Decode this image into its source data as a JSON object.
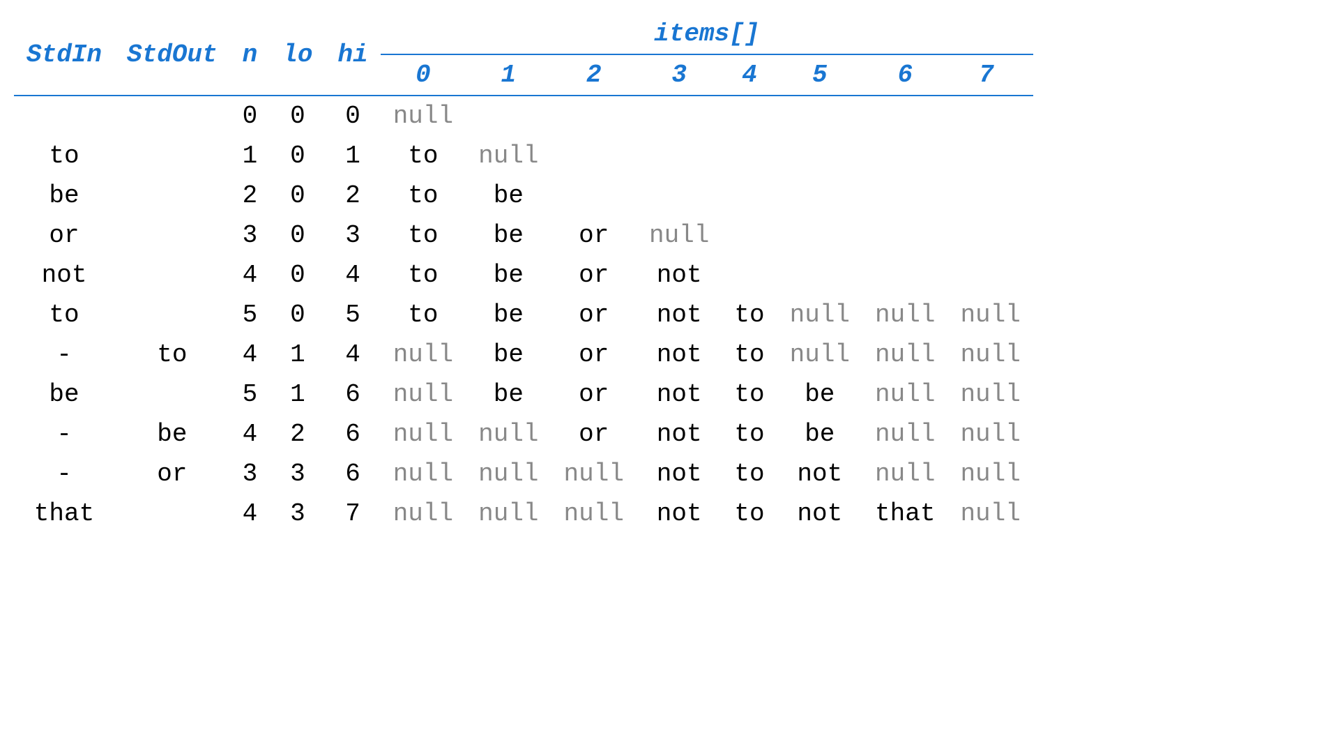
{
  "headers": {
    "stdin": "StdIn",
    "stdout": "StdOut",
    "n": "n",
    "lo": "lo",
    "hi": "hi",
    "items": "items[]",
    "indices": [
      "0",
      "1",
      "2",
      "3",
      "4",
      "5",
      "6",
      "7"
    ]
  },
  "rows": [
    {
      "stdin": "",
      "stdout": "",
      "n": "0",
      "lo": "0",
      "hi": "0",
      "items": [
        {
          "val": "null",
          "gray": true
        },
        {
          "val": "",
          "gray": false
        },
        {
          "val": "",
          "gray": false
        },
        {
          "val": "",
          "gray": false
        },
        {
          "val": "",
          "gray": false
        },
        {
          "val": "",
          "gray": false
        },
        {
          "val": "",
          "gray": false
        },
        {
          "val": "",
          "gray": false
        }
      ]
    },
    {
      "stdin": "to",
      "stdout": "",
      "n": "1",
      "lo": "0",
      "hi": "1",
      "items": [
        {
          "val": "to",
          "gray": false
        },
        {
          "val": "null",
          "gray": true
        },
        {
          "val": "",
          "gray": false
        },
        {
          "val": "",
          "gray": false
        },
        {
          "val": "",
          "gray": false
        },
        {
          "val": "",
          "gray": false
        },
        {
          "val": "",
          "gray": false
        },
        {
          "val": "",
          "gray": false
        }
      ]
    },
    {
      "stdin": "be",
      "stdout": "",
      "n": "2",
      "lo": "0",
      "hi": "2",
      "items": [
        {
          "val": "to",
          "gray": false
        },
        {
          "val": "be",
          "gray": false
        },
        {
          "val": "",
          "gray": false
        },
        {
          "val": "",
          "gray": false
        },
        {
          "val": "",
          "gray": false
        },
        {
          "val": "",
          "gray": false
        },
        {
          "val": "",
          "gray": false
        },
        {
          "val": "",
          "gray": false
        }
      ]
    },
    {
      "stdin": "or",
      "stdout": "",
      "n": "3",
      "lo": "0",
      "hi": "3",
      "items": [
        {
          "val": "to",
          "gray": false
        },
        {
          "val": "be",
          "gray": false
        },
        {
          "val": "or",
          "gray": false
        },
        {
          "val": "null",
          "gray": true
        },
        {
          "val": "",
          "gray": false
        },
        {
          "val": "",
          "gray": false
        },
        {
          "val": "",
          "gray": false
        },
        {
          "val": "",
          "gray": false
        }
      ]
    },
    {
      "stdin": "not",
      "stdout": "",
      "n": "4",
      "lo": "0",
      "hi": "4",
      "items": [
        {
          "val": "to",
          "gray": false
        },
        {
          "val": "be",
          "gray": false
        },
        {
          "val": "or",
          "gray": false
        },
        {
          "val": "not",
          "gray": false
        },
        {
          "val": "",
          "gray": false
        },
        {
          "val": "",
          "gray": false
        },
        {
          "val": "",
          "gray": false
        },
        {
          "val": "",
          "gray": false
        }
      ]
    },
    {
      "stdin": "to",
      "stdout": "",
      "n": "5",
      "lo": "0",
      "hi": "5",
      "items": [
        {
          "val": "to",
          "gray": false
        },
        {
          "val": "be",
          "gray": false
        },
        {
          "val": "or",
          "gray": false
        },
        {
          "val": "not",
          "gray": false
        },
        {
          "val": "to",
          "gray": false
        },
        {
          "val": "null",
          "gray": true
        },
        {
          "val": "null",
          "gray": true
        },
        {
          "val": "null",
          "gray": true
        }
      ]
    },
    {
      "stdin": "-",
      "stdout": "to",
      "n": "4",
      "lo": "1",
      "hi": "4",
      "items": [
        {
          "val": "null",
          "gray": true
        },
        {
          "val": "be",
          "gray": false
        },
        {
          "val": "or",
          "gray": false
        },
        {
          "val": "not",
          "gray": false
        },
        {
          "val": "to",
          "gray": false
        },
        {
          "val": "null",
          "gray": true
        },
        {
          "val": "null",
          "gray": true
        },
        {
          "val": "null",
          "gray": true
        }
      ]
    },
    {
      "stdin": "be",
      "stdout": "",
      "n": "5",
      "lo": "1",
      "hi": "6",
      "items": [
        {
          "val": "null",
          "gray": true
        },
        {
          "val": "be",
          "gray": false
        },
        {
          "val": "or",
          "gray": false
        },
        {
          "val": "not",
          "gray": false
        },
        {
          "val": "to",
          "gray": false
        },
        {
          "val": "be",
          "gray": false
        },
        {
          "val": "null",
          "gray": true
        },
        {
          "val": "null",
          "gray": true
        }
      ]
    },
    {
      "stdin": "-",
      "stdout": "be",
      "n": "4",
      "lo": "2",
      "hi": "6",
      "items": [
        {
          "val": "null",
          "gray": true
        },
        {
          "val": "null",
          "gray": true
        },
        {
          "val": "or",
          "gray": false
        },
        {
          "val": "not",
          "gray": false
        },
        {
          "val": "to",
          "gray": false
        },
        {
          "val": "be",
          "gray": false
        },
        {
          "val": "null",
          "gray": true
        },
        {
          "val": "null",
          "gray": true
        }
      ]
    },
    {
      "stdin": "-",
      "stdout": "or",
      "n": "3",
      "lo": "3",
      "hi": "6",
      "items": [
        {
          "val": "null",
          "gray": true
        },
        {
          "val": "null",
          "gray": true
        },
        {
          "val": "null",
          "gray": true
        },
        {
          "val": "not",
          "gray": false
        },
        {
          "val": "to",
          "gray": false
        },
        {
          "val": "not",
          "gray": false
        },
        {
          "val": "null",
          "gray": true
        },
        {
          "val": "null",
          "gray": true
        }
      ]
    },
    {
      "stdin": "that",
      "stdout": "",
      "n": "4",
      "lo": "3",
      "hi": "7",
      "items": [
        {
          "val": "null",
          "gray": true
        },
        {
          "val": "null",
          "gray": true
        },
        {
          "val": "null",
          "gray": true
        },
        {
          "val": "not",
          "gray": false
        },
        {
          "val": "to",
          "gray": false
        },
        {
          "val": "not",
          "gray": false
        },
        {
          "val": "that",
          "gray": false
        },
        {
          "val": "null",
          "gray": true
        }
      ]
    }
  ]
}
